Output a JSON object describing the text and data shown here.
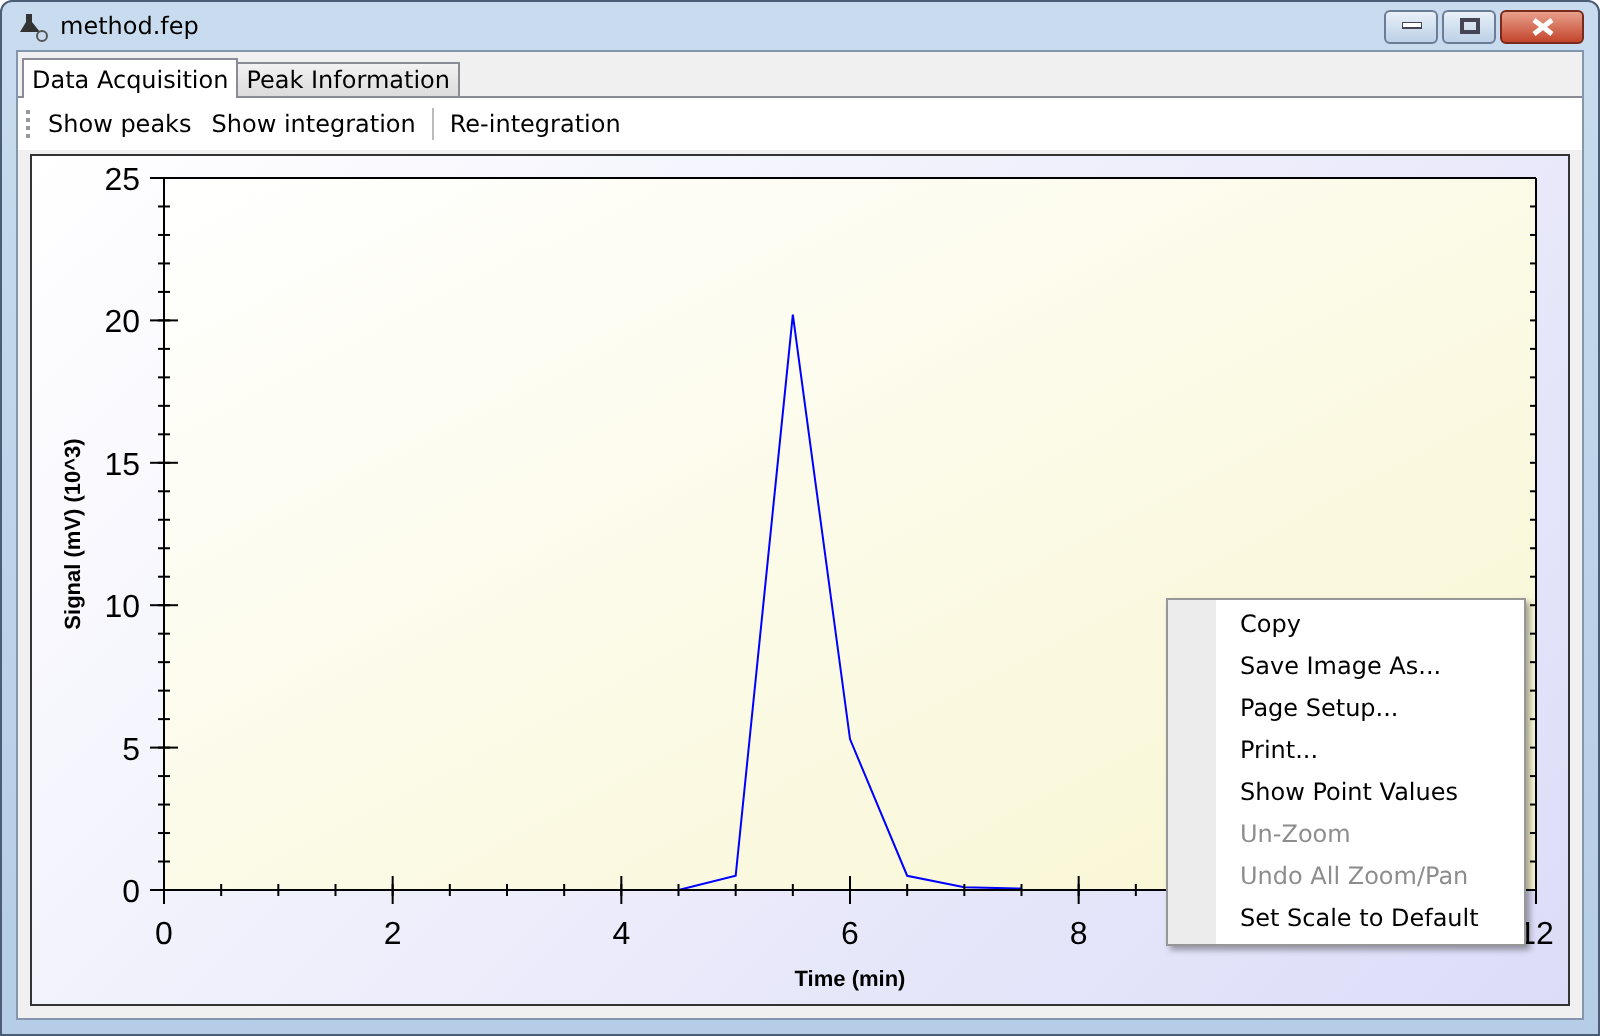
{
  "window": {
    "title": "method.fep"
  },
  "tabs": [
    {
      "label": "Data Acquisition",
      "selected": true
    },
    {
      "label": "Peak Information",
      "selected": false
    }
  ],
  "toolbar": [
    "Show peaks",
    "Show integration",
    "Re-integration"
  ],
  "chart": {
    "chart_data": {
      "type": "line",
      "xlabel": "Time (min)",
      "ylabel": "Signal (mV) (10^3)",
      "xlim": [
        0,
        12
      ],
      "ylim": [
        0,
        25
      ],
      "xticks": [
        0,
        2,
        4,
        6,
        8,
        12
      ],
      "yticks": [
        0,
        5,
        10,
        15,
        20,
        25
      ],
      "x": [
        4.5,
        5,
        5.5,
        6,
        6.5,
        7,
        7.5
      ],
      "series": [
        {
          "color": "#0000ff",
          "values": [
            0,
            0.5,
            20.2,
            5.3,
            0.5,
            0.1,
            0.05
          ]
        }
      ]
    }
  },
  "context_menu": [
    {
      "label": "Copy",
      "disabled": false
    },
    {
      "label": "Save Image As...",
      "disabled": false
    },
    {
      "label": "Page Setup...",
      "disabled": false
    },
    {
      "label": "Print...",
      "disabled": false
    },
    {
      "label": "Show Point Values",
      "disabled": false
    },
    {
      "label": "Un-Zoom",
      "disabled": true
    },
    {
      "label": "Undo All Zoom/Pan",
      "disabled": true
    },
    {
      "label": "Set Scale to Default",
      "disabled": false
    }
  ]
}
